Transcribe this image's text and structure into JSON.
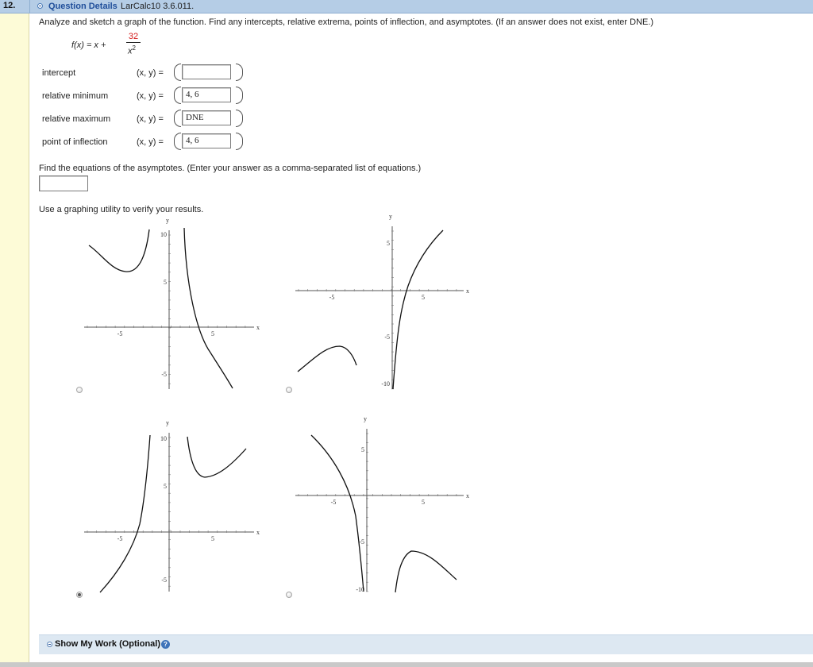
{
  "question": {
    "number": "12.",
    "details_label": "Question Details",
    "details_id": "LarCalc10 3.6.011.",
    "prompt": "Analyze and sketch a graph of the function. Find any intercepts, relative extrema, points of inflection, and asymptotes. (If an answer does not exist, enter DNE.)",
    "function": {
      "lhs": "f(x) = x +",
      "numerator": "32",
      "denominator": "x",
      "denominator_power": "2"
    }
  },
  "rows": [
    {
      "label": "intercept",
      "xy": "(x, y) =",
      "value": ""
    },
    {
      "label": "relative minimum",
      "xy": "(x, y) =",
      "value": "4, 6"
    },
    {
      "label": "relative maximum",
      "xy": "(x, y) =",
      "value": "DNE"
    },
    {
      "label": "point of inflection",
      "xy": "(x, y) =",
      "value": "4, 6"
    }
  ],
  "asymptotes": {
    "prompt": "Find the equations of the asymptotes. (Enter your answer as a comma-separated list of equations.)",
    "value": ""
  },
  "graphing": {
    "prompt": "Use a graphing utility to verify your results.",
    "selected_option": 3,
    "options": [
      {
        "ticks": {
          "x": [
            "-5",
            "5"
          ],
          "y": [
            "10",
            "5",
            "-5"
          ]
        },
        "axis_x": "x",
        "axis_y": "y"
      },
      {
        "ticks": {
          "x": [
            "-5",
            "5"
          ],
          "y": [
            "5",
            "-5",
            "-10"
          ]
        },
        "axis_x": "x",
        "axis_y": "y"
      },
      {
        "ticks": {
          "x": [
            "-5",
            "5"
          ],
          "y": [
            "10",
            "5",
            "-5"
          ]
        },
        "axis_x": "x",
        "axis_y": "y"
      },
      {
        "ticks": {
          "x": [
            "-5",
            "5"
          ],
          "y": [
            "5",
            "-5",
            "-10"
          ]
        },
        "axis_x": "x",
        "axis_y": "y"
      }
    ]
  },
  "show_work": {
    "label": "Show My Work (Optional)",
    "help": "?"
  },
  "colors": {
    "header_bar": "#b5cde6",
    "left_strip": "#fdfbd7",
    "link": "#1f4e9a",
    "accent_red": "#d41c1c",
    "show_work_bar": "#dde8f2"
  }
}
